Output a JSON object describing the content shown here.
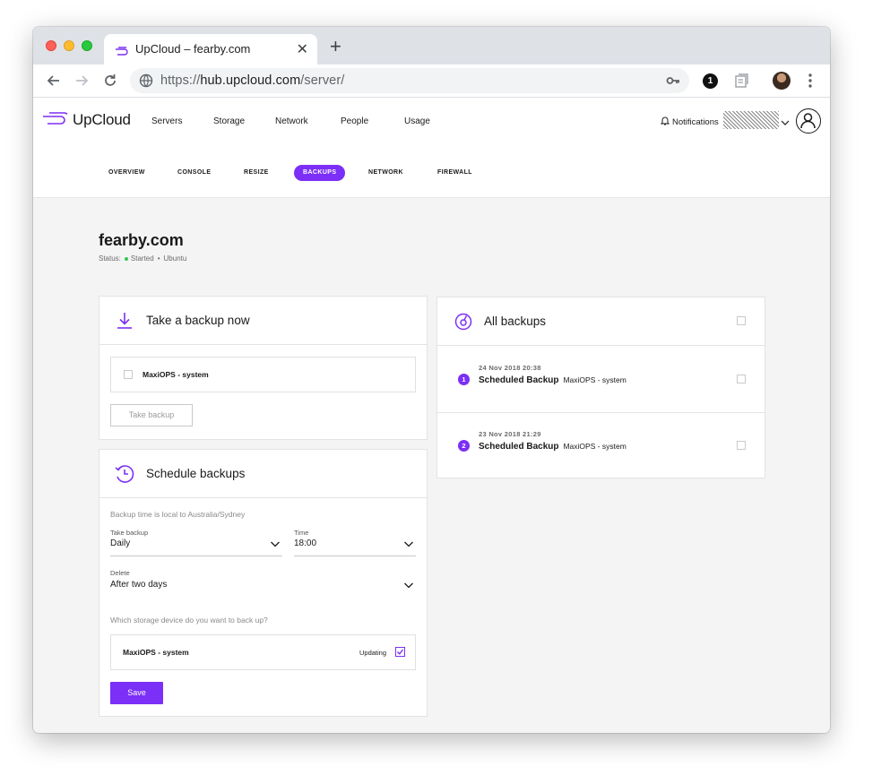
{
  "browser": {
    "tab_title": "UpCloud – fearby.com",
    "tab_close": "✕",
    "new_tab": "+",
    "url_scheme": "https://",
    "url_host": "hub.upcloud.com",
    "url_path": "/server/",
    "extension_badge": "1"
  },
  "header": {
    "logo_text": "UpCloud",
    "nav": [
      "Servers",
      "Storage",
      "Network",
      "People",
      "Usage"
    ],
    "notifications_label": "Notifications"
  },
  "subnav": {
    "tabs": [
      "OVERVIEW",
      "CONSOLE",
      "RESIZE",
      "BACKUPS",
      "NETWORK",
      "FIREWALL"
    ],
    "active": "BACKUPS"
  },
  "server": {
    "name": "fearby.com",
    "status_label": "Status:",
    "status_value": "Started",
    "separator": "•",
    "os": "Ubuntu"
  },
  "take_backup": {
    "title": "Take a backup now",
    "storage_label": "MaxiOPS - system",
    "button_label": "Take backup"
  },
  "schedule": {
    "title": "Schedule backups",
    "timezone_hint": "Backup time is local to Australia/Sydney",
    "frequency_label": "Take backup",
    "frequency_value": "Daily",
    "time_label": "Time",
    "time_value": "18:00",
    "delete_label": "Delete",
    "delete_value": "After two days",
    "storage_question": "Which storage device do you want to back up?",
    "storage_name": "MaxiOPS - system",
    "storage_status": "Updating",
    "storage_checked": true,
    "save_label": "Save"
  },
  "all_backups": {
    "title": "All backups",
    "items": [
      {
        "index": "1",
        "date": "24 Nov 2018 20:38",
        "type": "Scheduled Backup",
        "storage": "MaxiOPS - system"
      },
      {
        "index": "2",
        "date": "23 Nov 2018 21:29",
        "type": "Scheduled Backup",
        "storage": "MaxiOPS - system"
      }
    ]
  },
  "colors": {
    "accent": "#7b2ff7",
    "status_green": "#34c759"
  }
}
